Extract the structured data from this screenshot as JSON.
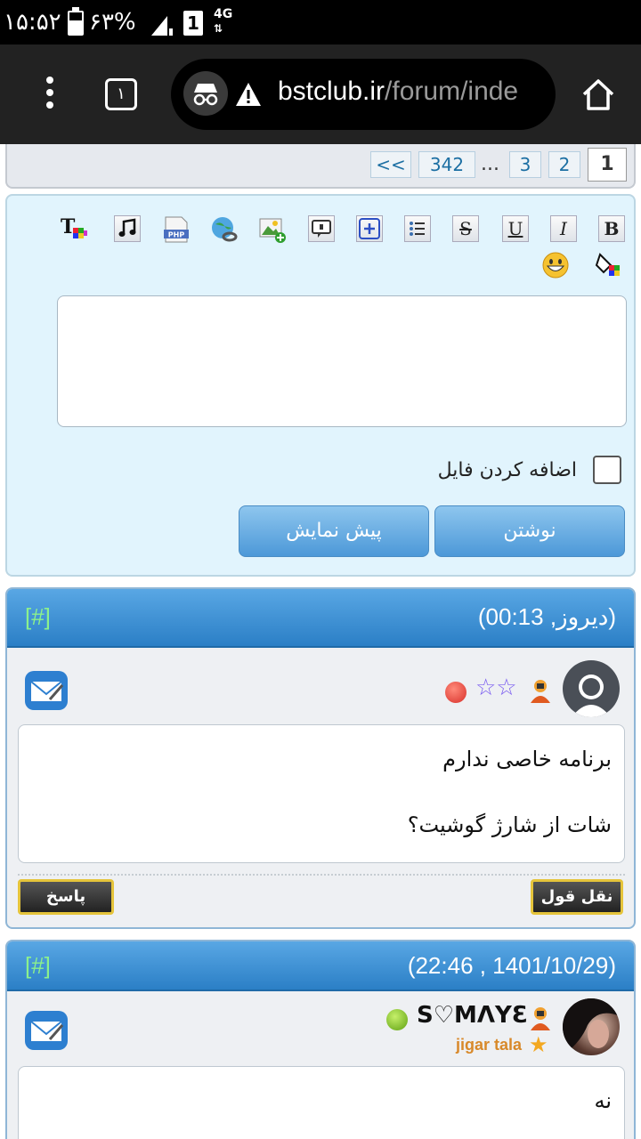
{
  "status_bar": {
    "time": "۱۵:۵۲",
    "battery": "۶۳%",
    "sim": "1",
    "network": "4G"
  },
  "browser": {
    "tab_count": "۱",
    "url_host": "bstclub.ir",
    "url_path": "/forum/inde"
  },
  "pager": {
    "prev": "<<",
    "last": "342",
    "ellipsis": "...",
    "pages": [
      "3",
      "2"
    ],
    "current": "1"
  },
  "compose": {
    "format_buttons": [
      "B",
      "I",
      "U",
      "S"
    ],
    "attach_label": "اضافه کردن فایل",
    "submit_label": "نوشتن",
    "preview_label": "پیش نمایش"
  },
  "posts": [
    {
      "date": "(دیروز, 00:13)",
      "anchor": "[#]",
      "stars": "☆☆",
      "status": "offline",
      "lines": [
        "برنامه خاصی ندارم",
        "شات از شارژ گوشیت؟"
      ],
      "quote_label": "نقل قول",
      "reply_label": "پاسخ"
    },
    {
      "date": "(22:46 , 1401/10/29)",
      "anchor": "[#]",
      "username": "S♡MΛYƐ",
      "user_title": "jigar tala",
      "status": "online",
      "lines": [
        "نه"
      ]
    }
  ],
  "colors": {
    "header_blue": "#2b7fc6",
    "compose_bg": "#e1f4fd",
    "online": "#7bc21e",
    "offline": "#e0463a"
  }
}
